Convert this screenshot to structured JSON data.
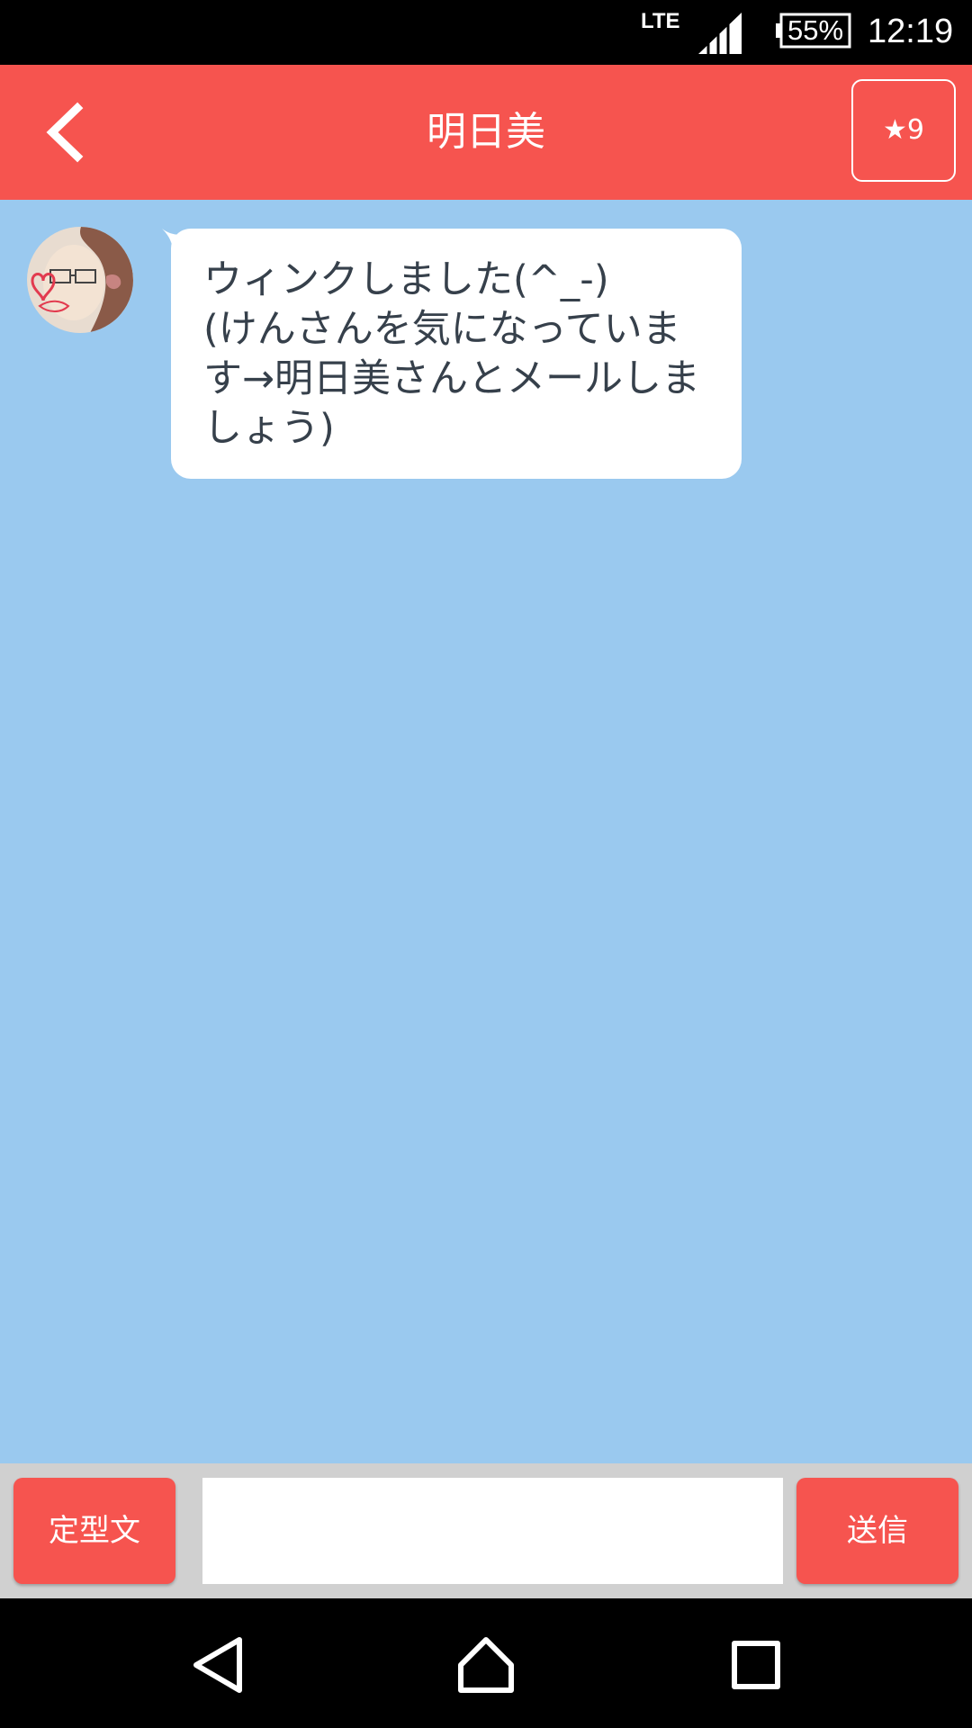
{
  "status_bar": {
    "network": "LTE",
    "battery": "55%",
    "time": "12:19"
  },
  "header": {
    "title": "明日美",
    "star_label": "★9",
    "back_icon": "chevron-left-icon"
  },
  "chat": {
    "messages": [
      {
        "sender": "明日美",
        "text": "ウィンクしました(^_-)\n(けんさんを気になっています→明日美さんとメールしましょう)"
      }
    ]
  },
  "input_bar": {
    "template_label": "定型文",
    "message_value": "",
    "message_placeholder": "",
    "send_label": "送信"
  },
  "colors": {
    "accent": "#f6544f",
    "chat_background": "#9ac9ef",
    "input_bar_background": "#d0d0d0",
    "bubble_text": "#36404b"
  }
}
